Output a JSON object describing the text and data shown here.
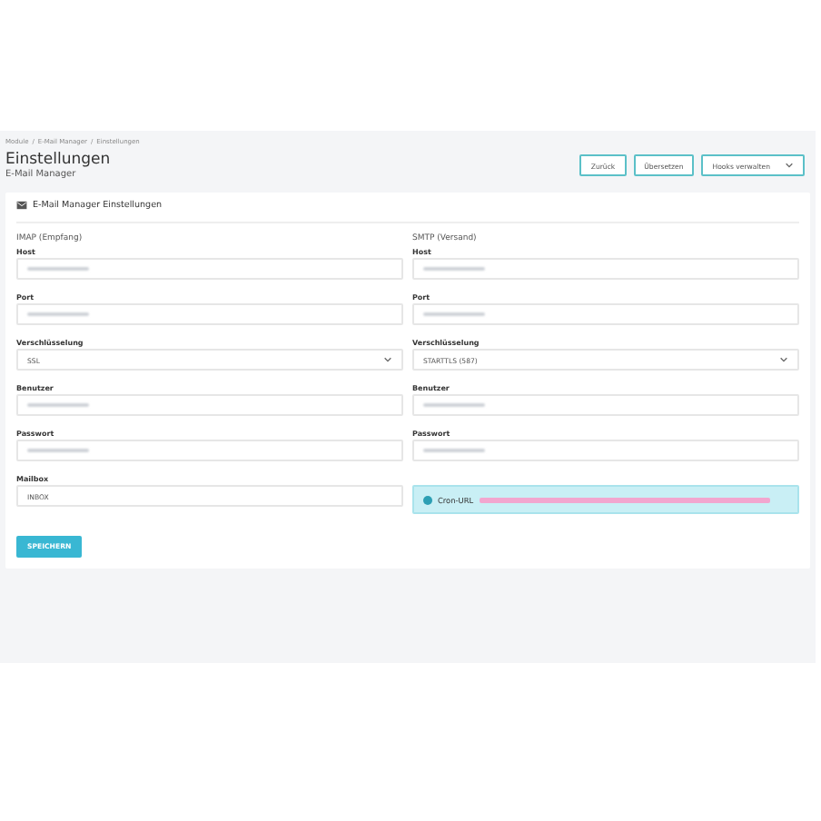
{
  "breadcrumb": {
    "separator": "/",
    "items": [
      "Module",
      "E-Mail Manager",
      "Einstellungen"
    ]
  },
  "header": {
    "title": "Einstellungen",
    "subtitle": "E-Mail Manager"
  },
  "actions": [
    {
      "label": "Zurück",
      "kind": "button"
    },
    {
      "label": "Übersetzen",
      "kind": "button"
    },
    {
      "label": "Hooks verwalten",
      "kind": "dropdown"
    }
  ],
  "card": {
    "title": "E-Mail Manager Einstellungen",
    "columns": [
      {
        "heading": "IMAP (Empfang)",
        "fields": [
          {
            "label": "Host",
            "kind": "blurred"
          },
          {
            "label": "Port",
            "kind": "blurred"
          },
          {
            "label": "Verschlüsselung",
            "kind": "select",
            "value": "SSL"
          },
          {
            "label": "Benutzer",
            "kind": "blurred"
          },
          {
            "label": "Passwort",
            "kind": "blurred"
          },
          {
            "label": "Mailbox",
            "kind": "text",
            "value": "INBOX"
          }
        ]
      },
      {
        "heading": "SMTP (Versand)",
        "fields": [
          {
            "label": "Host",
            "kind": "blurred"
          },
          {
            "label": "Port",
            "kind": "blurred"
          },
          {
            "label": "Verschlüsselung",
            "kind": "select",
            "value": "STARTTLS (587)"
          },
          {
            "label": "Benutzer",
            "kind": "blurred"
          },
          {
            "label": "Passwort",
            "kind": "blurred"
          },
          {
            "label": "Cron-URL",
            "kind": "info"
          }
        ]
      }
    ],
    "submit": "SPEICHERN"
  }
}
